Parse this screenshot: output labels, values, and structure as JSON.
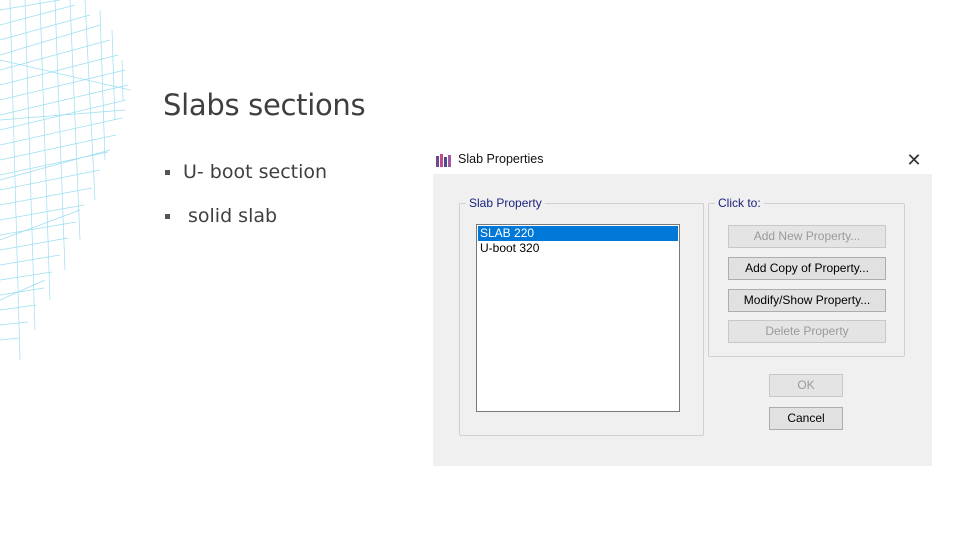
{
  "slide": {
    "title": "Slabs sections",
    "bullets": [
      "U- boot section",
      "solid slab"
    ]
  },
  "dialog": {
    "title": "Slab Properties",
    "close_glyph": "✕",
    "slab_property_group": {
      "legend": "Slab Property",
      "items": [
        "SLAB 220",
        "U-boot 320"
      ],
      "selected_index": 0
    },
    "click_to_group": {
      "legend": "Click to:",
      "add_new": "Add New Property...",
      "add_copy": "Add Copy of Property...",
      "modify_show": "Modify/Show Property...",
      "delete": "Delete Property"
    },
    "ok": "OK",
    "cancel": "Cancel"
  },
  "colors": {
    "selection": "#0078d7",
    "group_legend": "#1a237e",
    "wireframe": "#7fd3ee"
  },
  "icons": {
    "app": "etabs-app-icon",
    "close": "close-icon",
    "decor": "wireframe-decoration"
  }
}
